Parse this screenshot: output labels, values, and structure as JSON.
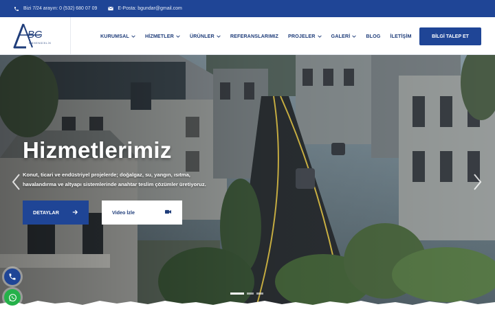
{
  "topbar": {
    "phone_text": "Bizi 7/24 arayın: 0 (532) 680 07 09",
    "email_text": "E-Posta: bgundar@gmail.com"
  },
  "logo": {
    "letters": "BG",
    "tagline": "MÜHENDİSLİK"
  },
  "nav": {
    "items": [
      {
        "label": "KURUMSAL",
        "dropdown": true
      },
      {
        "label": "HİZMETLER",
        "dropdown": true
      },
      {
        "label": "ÜRÜNLER",
        "dropdown": true
      },
      {
        "label": "REFERANSLARIMIZ",
        "dropdown": false
      },
      {
        "label": "PROJELER",
        "dropdown": true
      },
      {
        "label": "GALERİ",
        "dropdown": true
      },
      {
        "label": "BLOG",
        "dropdown": false
      },
      {
        "label": "İLETİŞİM",
        "dropdown": false
      }
    ],
    "cta_label": "BİLGİ TALEP ET"
  },
  "hero": {
    "title": "Hizmetlerimiz",
    "subtitle": "Konut, ticari ve endüstriyel projelerde; doğalgaz, su, yangın, ısıtma, havalandırma ve altyapı sistemlerinde anahtar teslim çözümler üretiyoruz.",
    "primary_button": "DETAYLAR",
    "secondary_button": "Video İzle",
    "slide_count": 3,
    "active_slide": 1
  },
  "colors": {
    "brand": "#1f4596",
    "nav_text": "#1f3d7a",
    "whatsapp": "#25b14a"
  },
  "icons": [
    "phone-icon",
    "mail-icon",
    "chevron-down-icon",
    "arrow-right-icon",
    "video-camera-icon",
    "chevron-left-icon",
    "chevron-right-icon",
    "whatsapp-icon"
  ]
}
